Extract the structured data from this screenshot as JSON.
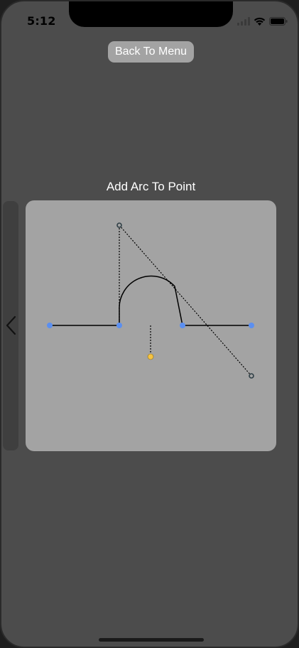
{
  "status_bar": {
    "time": "5:12",
    "icons": [
      "cellular-signal-icon",
      "wifi-icon",
      "battery-icon"
    ]
  },
  "header": {
    "back_button_label": "Back To Menu"
  },
  "demo": {
    "title": "Add Arc To Point",
    "side_handle_icon": "chevron-left-icon",
    "colors": {
      "canvas_background": "#a3a3a3",
      "endpoint_handle": "#5b8ff0",
      "control_handle_ring": "#2f3f46",
      "radius_handle": "#f5c342",
      "path_stroke": "#000000"
    }
  }
}
